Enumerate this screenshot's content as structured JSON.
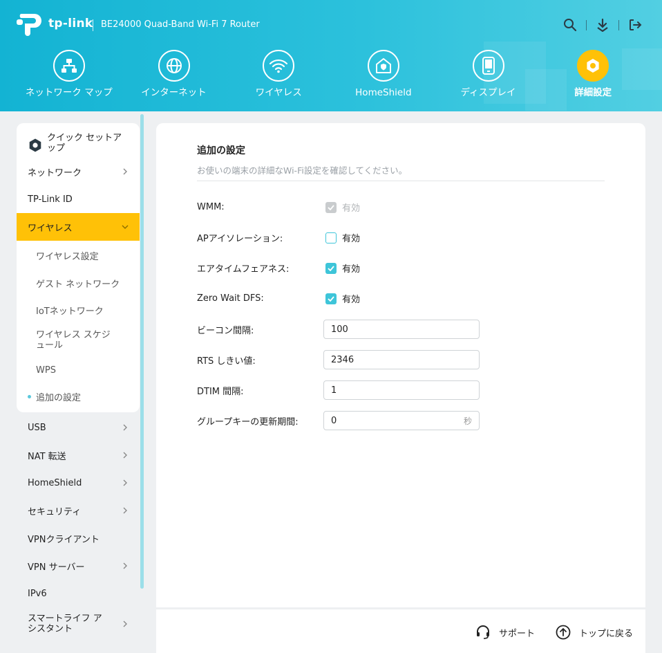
{
  "header": {
    "brand": "tp-link",
    "model": "BE24000 Quad-Band Wi-Fi 7 Router",
    "accent": "#1fb8d6",
    "active_color": "#ffc107",
    "tools": [
      "search-icon",
      "download-icon",
      "logout-icon"
    ]
  },
  "nav": {
    "tabs": [
      {
        "label": "ネットワーク マップ",
        "icon": "network-map-icon"
      },
      {
        "label": "インターネット",
        "icon": "globe-icon"
      },
      {
        "label": "ワイヤレス",
        "icon": "wifi-icon"
      },
      {
        "label": "HomeShield",
        "icon": "home-shield-icon"
      },
      {
        "label": "ディスプレイ",
        "icon": "display-icon"
      },
      {
        "label": "詳細設定",
        "icon": "gear-icon"
      }
    ],
    "active": "詳細設定"
  },
  "sidebar": {
    "quick_setup": "クイック セットアップ",
    "items": [
      {
        "label": "ネットワーク"
      },
      {
        "label": "TP-Link ID"
      },
      {
        "label": "ワイヤレス"
      },
      {
        "label": "USB"
      },
      {
        "label": "NAT 転送"
      },
      {
        "label": "HomeShield"
      },
      {
        "label": "セキュリティ"
      },
      {
        "label": "VPNクライアント"
      },
      {
        "label": "VPN サーバー"
      },
      {
        "label": "IPv6"
      },
      {
        "label": "スマートライフ アシスタント"
      }
    ],
    "sub_items": [
      {
        "label": "ワイヤレス設定"
      },
      {
        "label": "ゲスト ネットワーク"
      },
      {
        "label": "IoTネットワーク"
      },
      {
        "label": "ワイヤレス スケジュール"
      },
      {
        "label": "WPS"
      },
      {
        "label": "追加の設定"
      }
    ]
  },
  "main": {
    "title": "追加の設定",
    "description": "お使いの端末の詳細なWi-Fi設定を確認してください。",
    "enable_text": "有効",
    "rows": {
      "wmm": {
        "label": "WMM:",
        "checked": true,
        "disabled": true
      },
      "ap_isolation": {
        "label": "APアイソレーション:",
        "checked": false
      },
      "airtime": {
        "label": "エアタイムフェアネス:",
        "checked": true
      },
      "zero_wait": {
        "label": "Zero Wait DFS:",
        "checked": true
      },
      "beacon": {
        "label": "ビーコン間隔:",
        "value": "100"
      },
      "rts": {
        "label": "RTS しきい値:",
        "value": "2346"
      },
      "dtim": {
        "label": "DTIM 間隔:",
        "value": "1"
      },
      "group_key": {
        "label": "グループキーの更新期間:",
        "value": "0",
        "unit": "秒"
      }
    }
  },
  "footer": {
    "support": "サポート",
    "back_to_top": "トップに戻る"
  }
}
